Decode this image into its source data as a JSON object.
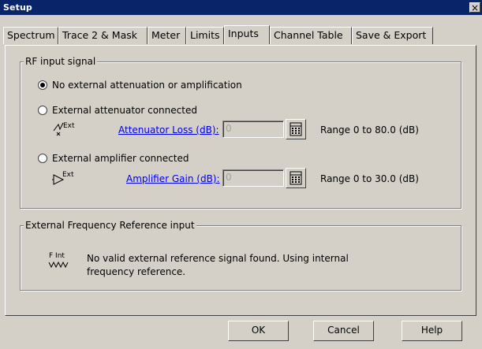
{
  "window": {
    "title": "Setup",
    "close_glyph": "×"
  },
  "tabs": [
    {
      "label": "Spectrum"
    },
    {
      "label": "Trace 2 & Mask"
    },
    {
      "label": "Meter"
    },
    {
      "label": "Limits"
    },
    {
      "label": "Inputs",
      "active": true
    },
    {
      "label": "Channel Table"
    },
    {
      "label": "Save & Export"
    }
  ],
  "rf_group": {
    "title": "RF input signal",
    "options": [
      {
        "label": "No external attenuation or amplification",
        "selected": true
      },
      {
        "label": "External attenuator connected",
        "selected": false
      },
      {
        "label": "External amplifier connected",
        "selected": false
      }
    ],
    "attenuator": {
      "icon_text": "Ext",
      "link_label": "Attenuator Loss (dB):",
      "value": "0",
      "range": "Range 0 to 80.0 (dB)"
    },
    "amplifier": {
      "icon_text": "Ext",
      "link_label": "Amplifier Gain (dB):",
      "value": "0",
      "range": "Range 0 to 30.0 (dB)"
    }
  },
  "freq_group": {
    "title": "External Frequency Reference input",
    "icon_text": "F Int",
    "message_line1": "No valid external reference signal found. Using internal",
    "message_line2": "frequency reference."
  },
  "buttons": {
    "ok": "OK",
    "cancel": "Cancel",
    "help": "Help"
  },
  "colors": {
    "titlebar": "#0a246a",
    "face": "#d4d0c8",
    "link": "#0000ee"
  }
}
